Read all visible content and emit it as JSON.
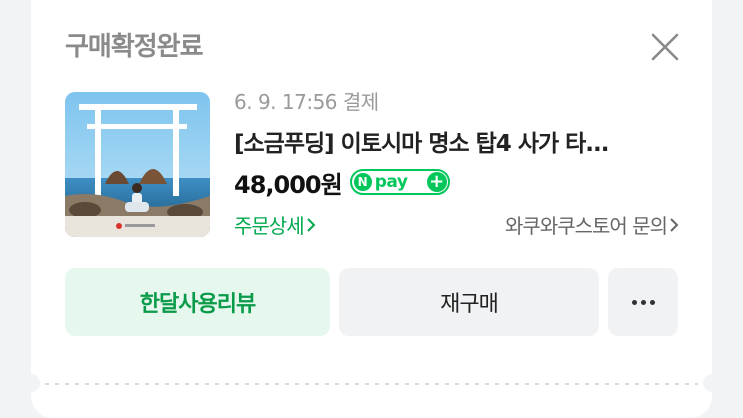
{
  "order": {
    "status_title": "구매확정완료",
    "purchase_date": "6. 9. 17:56 결제",
    "product_name": "[소금푸딩] 이토시마 명소 탑4 사가 타...",
    "price": "48,000원",
    "npay_label": "pay",
    "npay_n": "N",
    "npay_plus": "+",
    "order_detail_link": "주문상세",
    "store_inquiry_link": "와쿠와쿠스토어 문의"
  },
  "actions": {
    "review_label": "한달사용리뷰",
    "rebuy_label": "재구매"
  },
  "icons": {
    "close": "close-icon",
    "more": "more-horizontal-icon",
    "chevron": "chevron-right-icon"
  },
  "colors": {
    "accent_green": "#03c75a",
    "review_bg": "#e6f8ee",
    "review_text": "#0a9b4a",
    "neutral_button": "#f1f2f4",
    "status_gray": "#8a8a8a"
  }
}
